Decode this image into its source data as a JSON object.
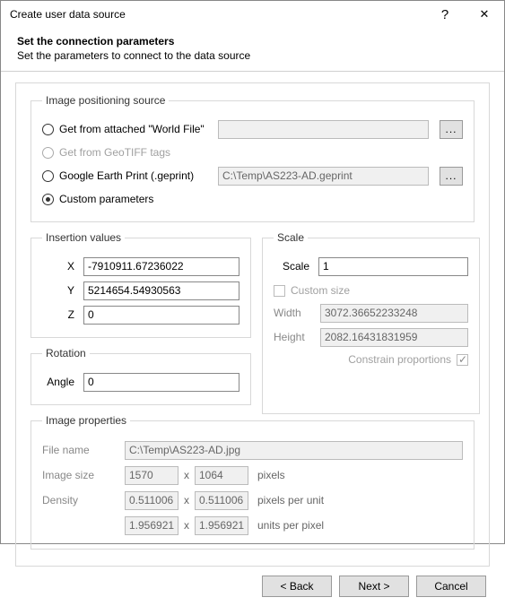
{
  "window": {
    "title": "Create user data source",
    "help": "?",
    "close": "✕"
  },
  "header": {
    "title": "Set the connection parameters",
    "subtitle": "Set the parameters to connect to the data source"
  },
  "positioning": {
    "legend": "Image positioning source",
    "worldfile_label": "Get from attached \"World File\"",
    "worldfile_path": "",
    "worldfile_browse": "...",
    "geotiff_label": "Get from GeoTIFF tags",
    "geprint_label": "Google Earth Print (.geprint)",
    "geprint_path": "C:\\Temp\\AS223-AD.geprint",
    "geprint_browse": "...",
    "custom_label": "Custom parameters"
  },
  "insertion": {
    "legend": "Insertion values",
    "x_label": "X",
    "x_value": "-7910911.67236022",
    "y_label": "Y",
    "y_value": "5214654.54930563",
    "z_label": "Z",
    "z_value": "0"
  },
  "rotation": {
    "legend": "Rotation",
    "angle_label": "Angle",
    "angle_value": "0"
  },
  "scale": {
    "legend": "Scale",
    "scale_label": "Scale",
    "scale_value": "1",
    "custom_size_label": "Custom size",
    "width_label": "Width",
    "width_value": "3072.36652233248",
    "height_label": "Height",
    "height_value": "2082.16431831959",
    "constrain_label": "Constrain proportions"
  },
  "props": {
    "legend": "Image properties",
    "filename_label": "File name",
    "filename_value": "C:\\Temp\\AS223-AD.jpg",
    "imagesize_label": "Image size",
    "imagesize_w": "1570",
    "imagesize_h": "1064",
    "imagesize_unit": "pixels",
    "density_label": "Density",
    "density_a": "0.511006",
    "density_b": "0.511006",
    "density_unit1": "pixels per unit",
    "upp_a": "1.956921",
    "upp_b": "1.956921",
    "upp_unit": "units per pixel",
    "times": "x"
  },
  "footer": {
    "back": "< Back",
    "next": "Next >",
    "cancel": "Cancel"
  }
}
